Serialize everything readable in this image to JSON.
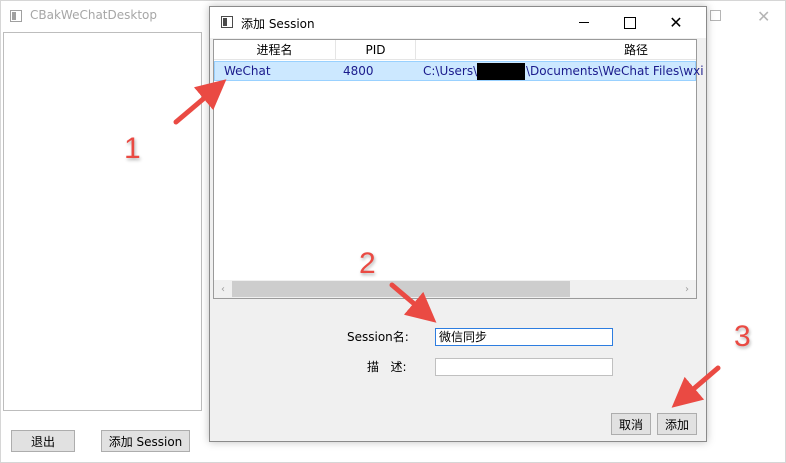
{
  "main_window": {
    "title": "CBakWeChatDesktop",
    "exit_label": "退出",
    "add_session_label": "添加 Session"
  },
  "dialog": {
    "title": "添加 Session",
    "columns": [
      "进程名",
      "PID",
      "",
      "路径"
    ],
    "rows": [
      {
        "process": "WeChat",
        "pid": "4800",
        "path_prefix": "C:\\Users\\",
        "path_suffix": "\\Documents\\WeChat Files\\wxi"
      }
    ],
    "form": {
      "session_label": "Session名:",
      "session_value": "微信同步",
      "desc_label": "描   述:",
      "desc_value": ""
    },
    "cancel_label": "取消",
    "add_label": "添加"
  },
  "annotations": {
    "marker_1": "1",
    "marker_2": "2",
    "marker_3": "3",
    "color": "#ea4a43"
  },
  "colors": {
    "selection_bg": "#cce8ff",
    "selection_border": "#99d1ff",
    "dialog_bg": "#f0f0f0",
    "button_bg": "#e1e1e1"
  }
}
